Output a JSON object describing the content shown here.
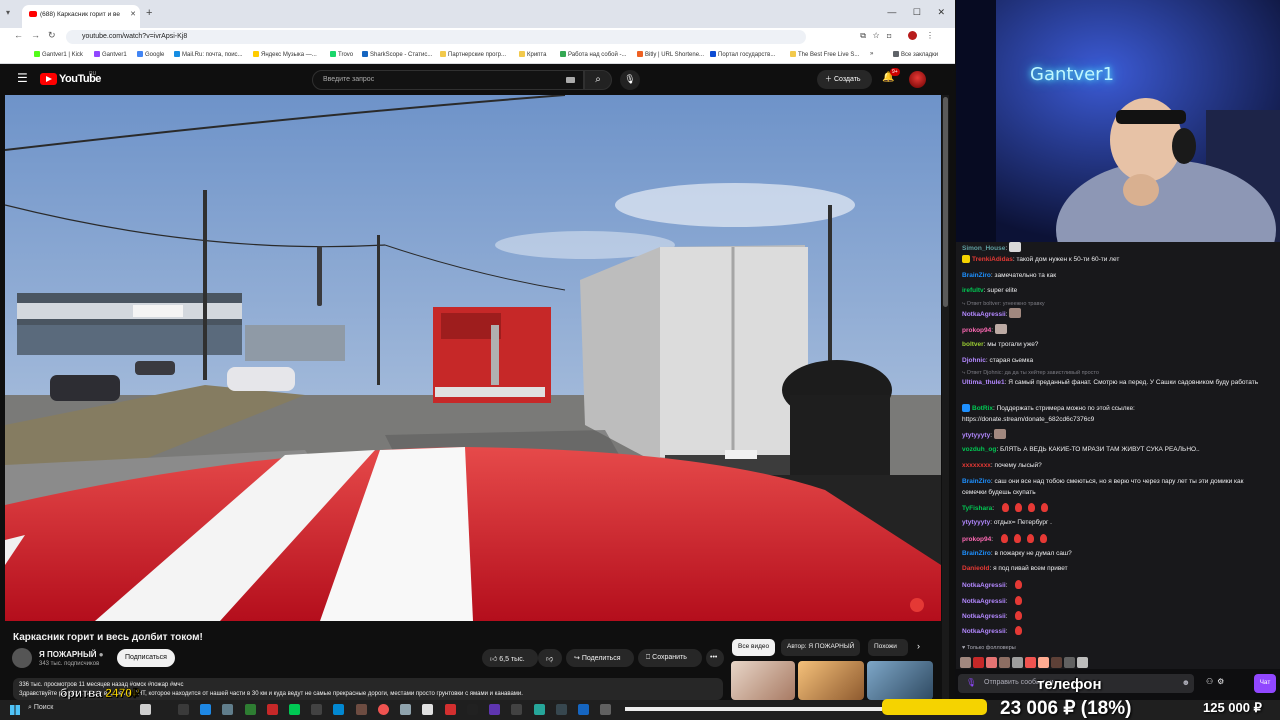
{
  "browser": {
    "tab_title": "(688) Каркасник горит и ве",
    "new_tab": "+",
    "url": "youtube.com/watch?v=ivrApsi-Kj8",
    "window_controls": "—  ☐  ✕",
    "bookmarks": [
      {
        "label": "Gantver1 | Kick",
        "color": "#53fc18"
      },
      {
        "label": "Gantver1",
        "color": "#9147ff"
      },
      {
        "label": "Google",
        "color": "#4285f4"
      },
      {
        "label": "Mail.Ru: почта, поис...",
        "color": "#168de2"
      },
      {
        "label": "Яндекс Музыка —...",
        "color": "#ffcc00"
      },
      {
        "label": "Trovo",
        "color": "#19d66b"
      },
      {
        "label": "SharkScope - Статис...",
        "color": "#1565c0"
      },
      {
        "label": "Партнерские прогр...",
        "color": "#f2c94c"
      },
      {
        "label": "Крипта",
        "color": "#f2c94c"
      },
      {
        "label": "Работа над собой -...",
        "color": "#34a853"
      },
      {
        "label": "Bitly | URL Shortene...",
        "color": "#ee6123"
      },
      {
        "label": "Портал государств...",
        "color": "#0d4cd3"
      },
      {
        "label": "The Best Free Live S...",
        "color": "#f2c94c"
      }
    ],
    "bookmarks_more": "»",
    "all_bookmarks": "Все закладки"
  },
  "youtube": {
    "logo_text": "YouTube",
    "logo_region": "RU",
    "search_placeholder": "Введите запрос",
    "create_label": "Создать",
    "notifications_badge": "9+",
    "video_title": "Каркасник горит и весь долбит током!",
    "channel_name": "Я ПОЖАРНЫЙ",
    "channel_subs": "343 тыс. подписчиков",
    "subscribe_label": "Подписаться",
    "likes": "6,5 тыс.",
    "share_label": "Поделиться",
    "save_label": "Сохранить",
    "more_label": "•••",
    "description_line1": "336 тыс. просмотров  11 месяцев назад  #омск #пожар #мчс",
    "description_line2": "Здравствуйте                            ры 2024. Вызов в далёкое СНТ, которое находится от нашей части в 30 км и куда ведут не самые прекрасные дороги, местами просто грунтовки с ямами и канавами.",
    "chips": [
      "Все видео",
      "Автор: Я ПОЖАРНЫЙ",
      "Похожи"
    ]
  },
  "overlays": {
    "razor_label": "бритва",
    "razor_price": "2470₽",
    "phone_label": "телефон",
    "donation_text": "23 006 ₽ (18%)",
    "donation_goal": "125 000 ₽",
    "donation_progress_percent": 18
  },
  "webcam": {
    "neon_sign": "Gantver1"
  },
  "chat": {
    "messages": [
      {
        "user": "Simon_House",
        "color": "#5f9ea0",
        "text": "",
        "emote": "#d9d9d9"
      },
      {
        "user": "TrenkiAdidas",
        "color": "#e53935",
        "text": "такой дом нужен к 50-ти 60-ти лет",
        "badge": "#f5d300"
      },
      {
        "user": "BrainZiro",
        "color": "#1e90ff",
        "text": "замечательно та как"
      },
      {
        "user": "irefultv",
        "color": "#00c853",
        "text": "super elite"
      },
      {
        "reply": "⤷ Ответ boltver: угнеежно травку"
      },
      {
        "user": "NotkaAgressii",
        "color": "#b388ff",
        "text": "",
        "emote": "#a1887f"
      },
      {
        "user": "prokop94",
        "color": "#ff69b4",
        "text": "",
        "emote": "#bcaaa4"
      },
      {
        "user": "boltver",
        "color": "#9acd32",
        "text": "мы трогали уже?"
      },
      {
        "user": "Djohnic",
        "color": "#b388ff",
        "text": "старая сьемка"
      },
      {
        "reply": "⤷ Ответ Djohnic: да да ты хейтер завистливый просто"
      },
      {
        "user": "Ultima_thule1",
        "color": "#b388ff",
        "text": "Я самый преданный фанат. Смотрю на перед. У Сашки садовником буду работать"
      },
      {
        "user": "BotRix",
        "color": "#00c853",
        "text": "Поддержать стримера можно по этой ссылке: https://donate.stream/donate_682cd6c7376c9",
        "badge": "#1e90ff"
      },
      {
        "user": "ytytyyyty",
        "color": "#b388ff",
        "text": "",
        "emote": "#a1887f"
      },
      {
        "user": "vozduh_og",
        "color": "#00c853",
        "text": "БЛЯТЬ А ВЕДЬ КАКИЕ-ТО МРАЗИ ТАМ ЖИВУТ СУКА РЕАЛЬНО.."
      },
      {
        "user": "xxxxxxxx",
        "color": "#e53935",
        "text": "почему лысый?"
      },
      {
        "user": "BrainZiro",
        "color": "#1e90ff",
        "text": "саш они все над тобою смеються, но я верю что через пару лет ты эти домики как семечки будешь скупать"
      },
      {
        "user": "TyFishara",
        "color": "#00c853",
        "text": "",
        "hearts": 4
      },
      {
        "user": "ytytyyyty",
        "color": "#b388ff",
        "text": "отдых= Петербург ."
      },
      {
        "user": "prokop94",
        "color": "#ff69b4",
        "text": "",
        "hearts": 4
      },
      {
        "user": "BrainZiro",
        "color": "#1e90ff",
        "text": "в пожарку не думал саш?"
      },
      {
        "user": "Danieold",
        "color": "#e53935",
        "text": "я под пивай всем привет"
      },
      {
        "user": "NotkaAgressii",
        "color": "#b388ff",
        "text": "",
        "hearts": 1
      },
      {
        "user": "NotkaAgressii",
        "color": "#b388ff",
        "text": "",
        "hearts": 1
      },
      {
        "user": "NotkaAgressii",
        "color": "#b388ff",
        "text": "",
        "hearts": 1
      },
      {
        "user": "NotkaAgressii",
        "color": "#b388ff",
        "text": "",
        "hearts": 1
      }
    ],
    "followers_only": "♥ Только фолловеры",
    "input_placeholder": "Отправить сообщение",
    "send_label": "Чат"
  },
  "taskbar": {
    "search_label": "Поиск"
  }
}
